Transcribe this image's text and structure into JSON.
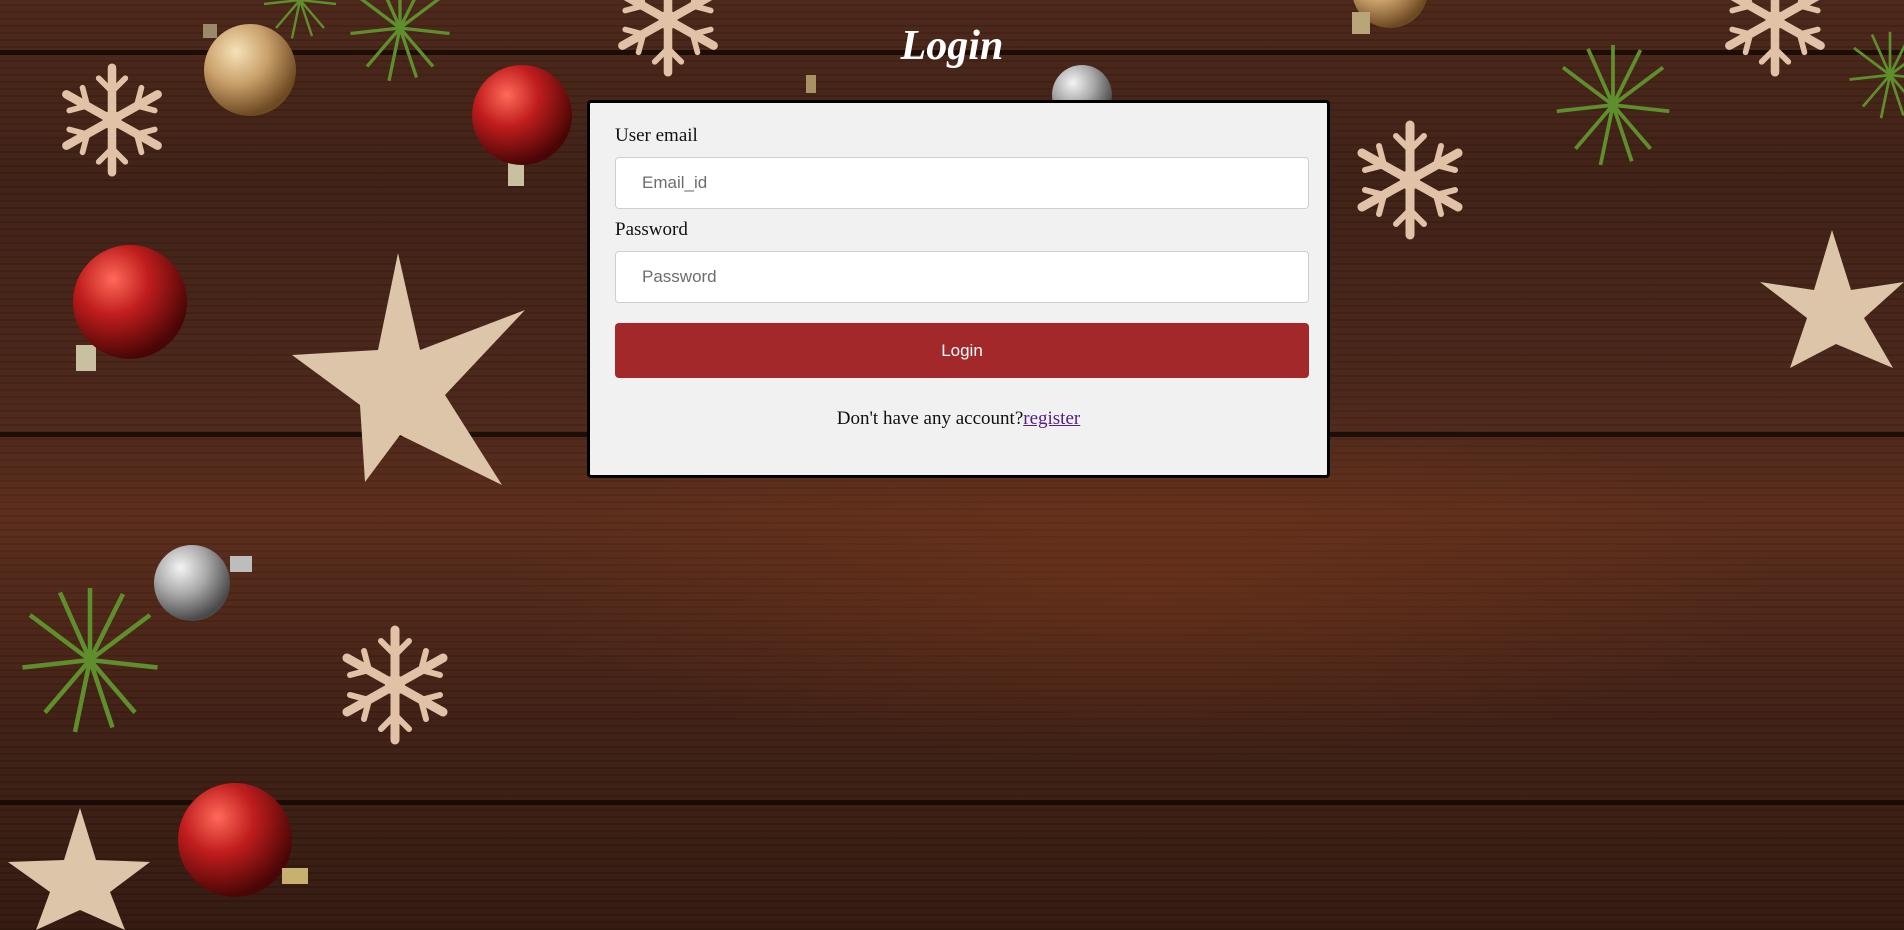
{
  "page": {
    "title": "Login"
  },
  "form": {
    "email_label": "User email",
    "email_placeholder": "Email_id",
    "email_value": "",
    "password_label": "Password",
    "password_placeholder": "Password",
    "password_value": "",
    "submit_label": "Login",
    "register_prompt": "Don't have any account?",
    "register_link": "register"
  },
  "colors": {
    "accent": "#a3282a",
    "card_background": "#f1f1f1",
    "background_wood": "#3e2015"
  },
  "background_decor": [
    "wood-planks",
    "snowflake-ornament",
    "star-ornament",
    "red-bauble",
    "gold-bauble",
    "silver-bauble",
    "pine-branch"
  ]
}
